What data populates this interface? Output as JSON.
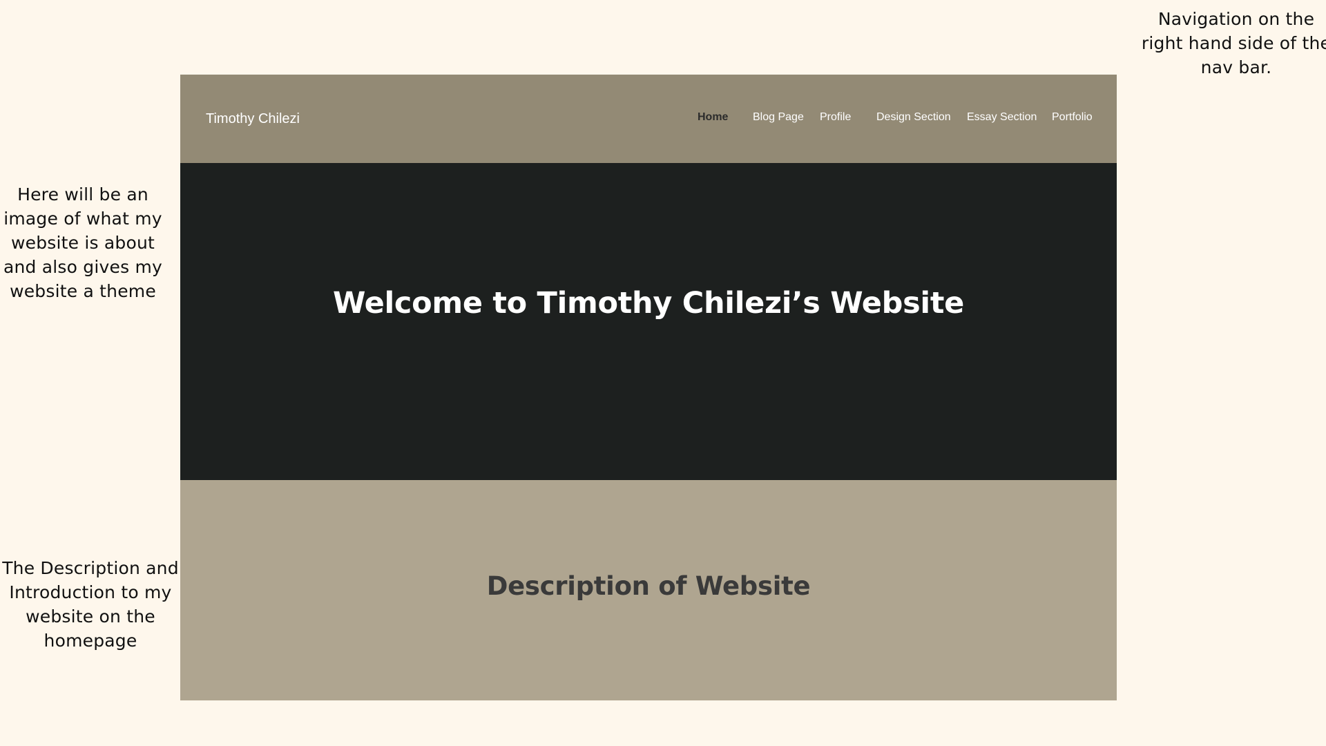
{
  "annotations": {
    "nav_note": "Navigation on the right hand side of the nav bar.",
    "hero_note": "Here will be an image of what my website is about and also gives my website a theme",
    "description_note": "The Description and Introduction to my website on the homepage"
  },
  "site": {
    "title": "Timothy Chilezi"
  },
  "nav": {
    "items": [
      {
        "label": "Home",
        "active": true
      },
      {
        "label": "Blog Page",
        "active": false
      },
      {
        "label": "Profile",
        "active": false
      },
      {
        "label": "Design Section",
        "active": false
      },
      {
        "label": "Essay Section",
        "active": false
      },
      {
        "label": "Portfolio",
        "active": false
      }
    ]
  },
  "hero": {
    "title": "Welcome to Timothy Chilezi’s Website"
  },
  "description": {
    "title": "Description of Website"
  },
  "colors": {
    "page_background": "#fef7ec",
    "navbar": "#938a75",
    "hero": "#1d201f",
    "description_section": "#afa590"
  }
}
